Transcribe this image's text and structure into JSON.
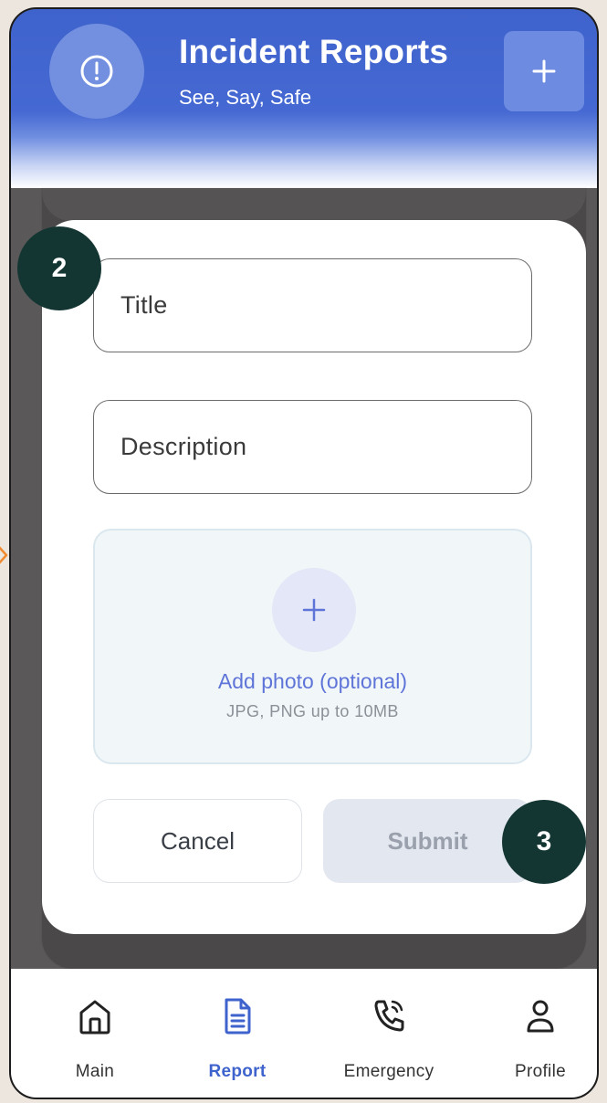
{
  "header": {
    "title": "Incident Reports",
    "subtitle": "See, Say, Safe",
    "alert_icon": "alert-circle-icon",
    "add_icon": "plus-icon"
  },
  "form": {
    "title_placeholder": "Title",
    "description_placeholder": "Description",
    "photo": {
      "label": "Add photo (optional)",
      "hint": "JPG, PNG up to 10MB",
      "icon": "plus-icon"
    },
    "cancel_label": "Cancel",
    "submit_label": "Submit"
  },
  "badges": {
    "step_two": "2",
    "step_three": "3"
  },
  "nav": {
    "items": [
      {
        "label": "Main",
        "icon": "home-icon",
        "active": false
      },
      {
        "label": "Report",
        "icon": "document-icon",
        "active": true
      },
      {
        "label": "Emergency",
        "icon": "phone-call-icon",
        "active": false
      },
      {
        "label": "Profile",
        "icon": "user-icon",
        "active": false
      }
    ]
  },
  "colors": {
    "brand": "#3f63cc",
    "badge": "#143633",
    "accent_link": "#5f74d8"
  }
}
